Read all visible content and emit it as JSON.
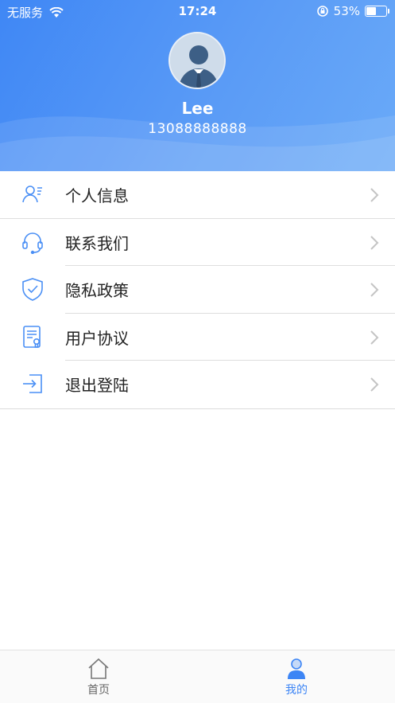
{
  "status_bar": {
    "carrier": "无服务",
    "time": "17:24",
    "battery_text": "53%",
    "battery_level": 0.53
  },
  "profile": {
    "name": "Lee",
    "phone": "13088888888"
  },
  "menu": [
    {
      "label": "个人信息",
      "icon": "user-info-icon"
    },
    {
      "label": "联系我们",
      "icon": "headset-icon"
    },
    {
      "label": "隐私政策",
      "icon": "shield-check-icon"
    },
    {
      "label": "用户协议",
      "icon": "document-icon"
    },
    {
      "label": "退出登陆",
      "icon": "logout-icon"
    }
  ],
  "tabbar": {
    "home_label": "首页",
    "mine_label": "我的",
    "active_color": "#3d85f5",
    "inactive_color": "#666666"
  },
  "colors": {
    "accent": "#4a8ff5",
    "header_gradient_start": "#3f87f5",
    "header_gradient_end": "#6aaaf8"
  }
}
